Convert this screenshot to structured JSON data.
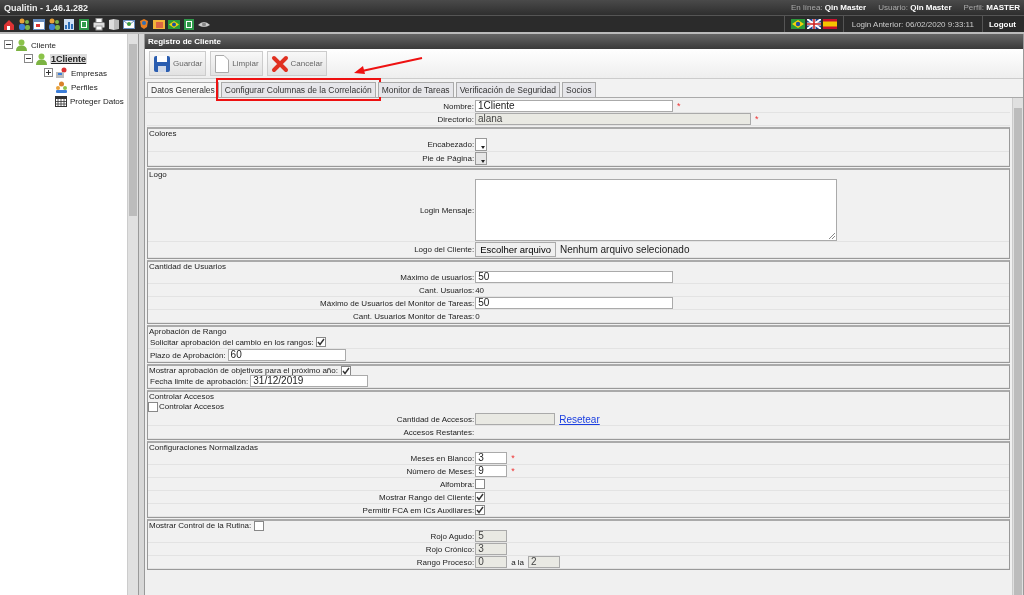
{
  "window": {
    "title": "Qualitin - 1.46.1.282"
  },
  "session": [
    {
      "label": "En línea:",
      "value": "Qin Master"
    },
    {
      "label": "Usuario:",
      "value": "Qin Master"
    },
    {
      "label": "Perfil:",
      "value": "MASTER"
    }
  ],
  "last_login": "Login Anterior: 06/02/2020 9:33:11",
  "logout": "Logout",
  "tree": [
    {
      "label": "Cliente",
      "kind": "user",
      "expanded": true,
      "selected": false,
      "children": [
        {
          "label": "1Cliente",
          "kind": "user",
          "expanded": true,
          "selected": true,
          "children": [
            {
              "label": "Empresas",
              "kind": "company",
              "expanded": false,
              "selected": false
            },
            {
              "label": "Perfiles",
              "kind": "profiles",
              "selected": false
            },
            {
              "label": "Proteger Datos",
              "kind": "calendar",
              "selected": false
            }
          ]
        }
      ]
    }
  ],
  "panel_title": "Registro de Cliente",
  "toolbar": [
    {
      "label": "Guardar",
      "kind": "save"
    },
    {
      "label": "Limpiar",
      "kind": "clear"
    },
    {
      "label": "Cancelar",
      "kind": "cancel"
    }
  ],
  "tabs": [
    {
      "label": "Datos Generales",
      "selected": true,
      "highlighted": false
    },
    {
      "label": "Configurar Columnas de la Correlación",
      "selected": false,
      "highlighted": true
    },
    {
      "label": "Monitor de Tareas",
      "selected": false,
      "highlighted": false
    },
    {
      "label": "Verificación de Seguridad",
      "selected": false,
      "highlighted": false
    },
    {
      "label": "Socios",
      "selected": false,
      "highlighted": false
    }
  ],
  "sections": [
    {
      "rows": [
        {
          "kind": "text",
          "label": "Nombre:",
          "value": "1Cliente",
          "disabled": false,
          "mark": "*"
        },
        {
          "kind": "wide_text",
          "label": "Directorio:",
          "value": "alana",
          "disabled": true,
          "mark": "*"
        }
      ]
    },
    {
      "legend": "Colores",
      "rows": [
        {
          "kind": "color",
          "label": "Encabezado:",
          "disabled": false
        },
        {
          "kind": "color",
          "label": "Pie de Página:",
          "disabled": true
        }
      ]
    },
    {
      "legend": "Logo",
      "rows": [
        {
          "kind": "textarea",
          "label": "Login Mensaje:"
        },
        {
          "kind": "file",
          "label": "Logo del Cliente:",
          "button": "Escolher arquivo",
          "status": "Nenhum arquivo selecionado"
        }
      ]
    },
    {
      "legend": "Cantidad de Usuarios",
      "rows": [
        {
          "kind": "text",
          "label": "Máximo de usuarios:",
          "value": "50",
          "disabled": false
        },
        {
          "kind": "value",
          "label": "Cant. Usuarios:",
          "value": "40"
        },
        {
          "kind": "text",
          "label": "Máximo de Usuarios del Monitor de Tareas:",
          "value": "50",
          "disabled": false
        },
        {
          "kind": "value",
          "label": "Cant. Usuarios Monitor de Tareas:",
          "value": "0"
        }
      ]
    },
    {
      "legend": "Aprobación de Rango",
      "rows": [
        {
          "kind": "inline_checkbox",
          "label": "Solicitar aprobación del cambio en los rangos:",
          "checked": true
        },
        {
          "kind": "inline_text",
          "label": "Plazo de Aprobación:",
          "value": "60"
        }
      ]
    },
    {
      "legend": "Mostrar aprobación de objetivos para el próximo año:",
      "legend_checked": true,
      "rows": [
        {
          "kind": "inline_text",
          "label": "Fecha limite de aprobación:",
          "value": "31/12/2019"
        }
      ]
    },
    {
      "legend": "Controlar Accesos",
      "rows": [
        {
          "kind": "lead_checkbox",
          "label": "Controlar Accesos",
          "checked": false
        },
        {
          "kind": "medium_text",
          "label": "Cantidad de Accesos:",
          "disabled": true,
          "link": "Resetear"
        },
        {
          "kind": "value",
          "label": "Accesos Restantes:"
        }
      ]
    },
    {
      "legend": "Configuraciones Normalizadas",
      "rows": [
        {
          "kind": "short_text",
          "label": "Meses en Blanco:",
          "value": "3",
          "disabled": false,
          "mark": "*"
        },
        {
          "kind": "short_text",
          "label": "Número de Meses:",
          "value": "9",
          "disabled": false,
          "mark": "*"
        },
        {
          "kind": "checkbox",
          "label": "Alfombra:",
          "checked": false
        },
        {
          "kind": "checkbox",
          "label": "Mostrar Rango del Cliente:",
          "checked": true
        },
        {
          "kind": "checkbox",
          "label": "Permitir FCA em ICs Auxiliares:",
          "checked": true
        }
      ]
    },
    {
      "legend": "Mostrar Control de la Rutina:",
      "legend_checked": false,
      "rows": [
        {
          "kind": "short_text",
          "label": "Rojo Agudo:",
          "value": "5",
          "disabled": true
        },
        {
          "kind": "short_text",
          "label": "Rojo Crónico:",
          "value": "3",
          "disabled": true
        },
        {
          "kind": "range",
          "label": "Rango Proceso:",
          "value": "0",
          "separator": "a la",
          "value_2": "2",
          "disabled": true
        }
      ]
    }
  ]
}
